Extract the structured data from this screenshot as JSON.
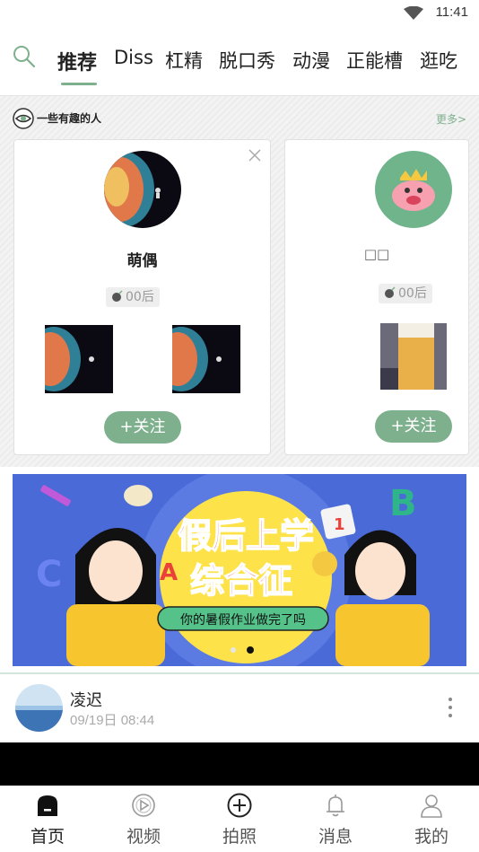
{
  "status": {
    "time": "11:41"
  },
  "tabs": [
    {
      "label": "推荐",
      "active": true
    },
    {
      "label": "Diss"
    },
    {
      "label": "杠精"
    },
    {
      "label": "脱口秀"
    },
    {
      "label": "动漫"
    },
    {
      "label": "正能槽"
    },
    {
      "label": "逛吃"
    }
  ],
  "interest": {
    "title": "一些有趣的人",
    "more": "更多>",
    "cards": [
      {
        "name": "萌偶",
        "age": "00后",
        "follow": "+关注"
      },
      {
        "name": "□□",
        "age": "00后",
        "follow": "+关注"
      }
    ]
  },
  "banner": {
    "headline_line1": "假后上学",
    "headline_line2": "综合征",
    "subtitle": "你的暑假作业做完了吗",
    "letters": [
      "A",
      "B",
      "C",
      "1"
    ],
    "pages": 2,
    "active_page": 2
  },
  "post": {
    "author": "凌迟",
    "time": "09/19日 08:44"
  },
  "bottom_nav": [
    {
      "label": "首页",
      "icon": "home-icon",
      "active": true
    },
    {
      "label": "视频",
      "icon": "video-play-icon"
    },
    {
      "label": "拍照",
      "icon": "add-circle-icon"
    },
    {
      "label": "消息",
      "icon": "bell-icon"
    },
    {
      "label": "我的",
      "icon": "user-icon"
    }
  ],
  "colors": {
    "accent": "#7fb08e",
    "banner_bg": "#4a6ad8",
    "banner_circle": "#fde24a"
  }
}
